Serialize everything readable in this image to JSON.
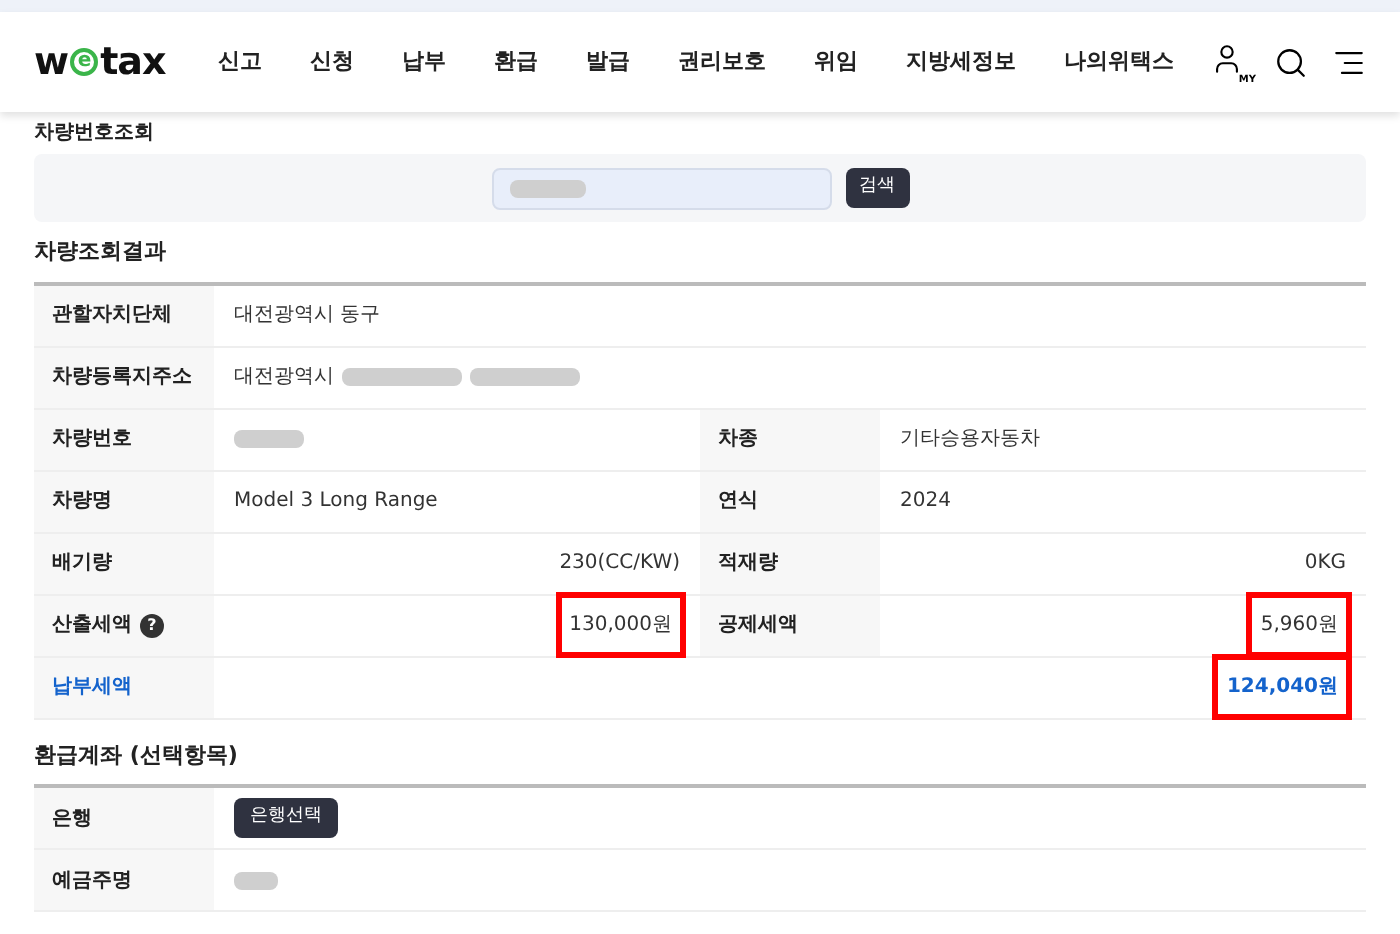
{
  "nav": {
    "logo": {
      "prefix": "w",
      "mark": "e",
      "suffix": "tax"
    },
    "menu": [
      "신고",
      "신청",
      "납부",
      "환급",
      "발급",
      "권리보호",
      "위임",
      "지방세정보",
      "나의위택스"
    ],
    "user_badge": "MY"
  },
  "search": {
    "title": "차량번호조회",
    "field_redacted": true,
    "button": "검색"
  },
  "result": {
    "title": "차량조회결과",
    "rows": [
      {
        "kind": "full",
        "label": "관할자치단체",
        "value": {
          "text": "대전광역시 동구"
        }
      },
      {
        "kind": "full",
        "label": "차량등록지주소",
        "value": {
          "text": "대전광역시",
          "redacted": true
        }
      },
      {
        "kind": "pair",
        "cells": [
          {
            "label": "차량번호",
            "value": {
              "redacted": true
            }
          },
          {
            "label": "차종",
            "value": {
              "text": "기타승용자동차"
            }
          }
        ]
      },
      {
        "kind": "pair",
        "cells": [
          {
            "label": "차량명",
            "value": {
              "text": "Model 3 Long Range"
            }
          },
          {
            "label": "연식",
            "value": {
              "text": "2024"
            }
          }
        ]
      },
      {
        "kind": "pair",
        "cells": [
          {
            "label": "배기량",
            "value": {
              "text": "230(CC/KW)",
              "right_aligned": true
            }
          },
          {
            "label": "적재량",
            "value": {
              "text": "0KG",
              "right_aligned": true
            }
          }
        ]
      },
      {
        "kind": "pair",
        "cells": [
          {
            "label": "산출세액",
            "help": "?",
            "value": {
              "text": "130,000원",
              "right_aligned": true,
              "highlighted": true
            }
          },
          {
            "label": "공제세액",
            "value": {
              "text": "5,960원",
              "right_aligned": true,
              "highlighted": true
            }
          }
        ]
      },
      {
        "kind": "full",
        "label": "납부세액",
        "emphasis": true,
        "value": {
          "text": "124,040원",
          "right_aligned": true,
          "highlighted": true
        }
      }
    ]
  },
  "refund": {
    "title": "환급계좌 (선택항목)",
    "rows": [
      {
        "kind": "button",
        "label": "은행",
        "button": "은행선택"
      },
      {
        "kind": "redacted",
        "label": "예금주명"
      }
    ]
  }
}
